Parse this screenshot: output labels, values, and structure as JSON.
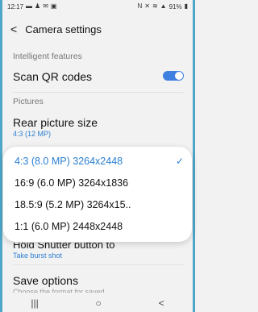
{
  "status_bar": {
    "time": "12:17",
    "left_icons": [
      "chat-icon",
      "person-icon",
      "mail-icon",
      "image-icon"
    ],
    "right_icons": [
      "nfc-icon",
      "mute-icon",
      "wifi-icon",
      "signal-icon"
    ],
    "battery": "91%"
  },
  "header": {
    "title": "Camera settings"
  },
  "sections": {
    "intelligent": "Intelligent features",
    "pictures": "Pictures"
  },
  "scan_qr": {
    "label": "Scan QR codes",
    "enabled": true
  },
  "rear_size": {
    "label": "Rear picture size",
    "value": "4:3 (12 MP)"
  },
  "dropdown": {
    "options": [
      {
        "label": "4:3 (8.0 MP) 3264x2448",
        "selected": true
      },
      {
        "label": "16:9 (6.0 MP) 3264x1836",
        "selected": false
      },
      {
        "label": "18.5:9 (5.2 MP) 3264x15..",
        "selected": false
      },
      {
        "label": "1:1 (6.0 MP) 2448x2448",
        "selected": false
      }
    ]
  },
  "hold_shutter": {
    "label": "Hold Shutter button to",
    "value": "Take burst shot"
  },
  "save_options": {
    "label": "Save options",
    "desc": "Choose the format for saved"
  },
  "nav": {
    "recents": "|||",
    "home": "○",
    "back": "<"
  },
  "colors": {
    "accent": "#2a7fd1",
    "toggle": "#3e7fe0"
  }
}
